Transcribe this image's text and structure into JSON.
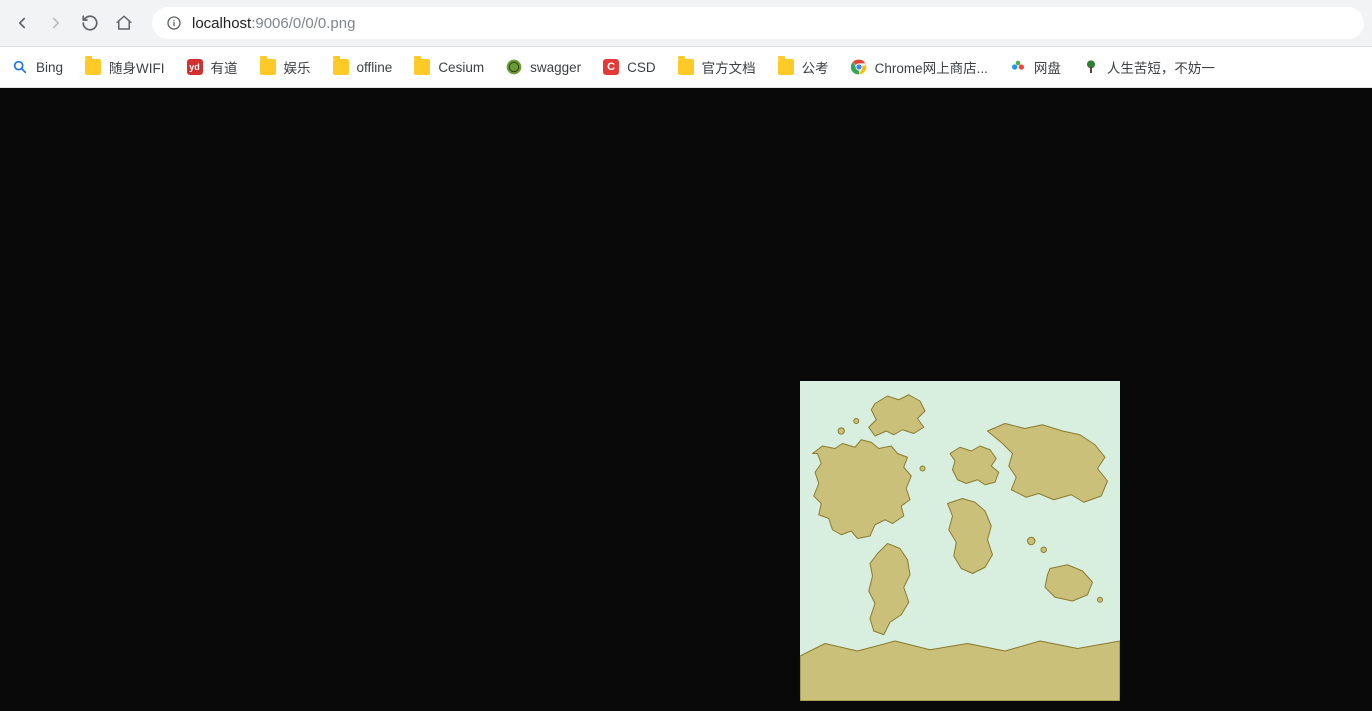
{
  "address": {
    "host": "localhost",
    "port_path": ":9006/0/0/0.png"
  },
  "bookmarks": [
    {
      "label": "Bing",
      "icon": "bing"
    },
    {
      "label": "随身WIFI",
      "icon": "folder"
    },
    {
      "label": "有道",
      "icon": "youdao"
    },
    {
      "label": "娱乐",
      "icon": "folder"
    },
    {
      "label": "offline",
      "icon": "folder"
    },
    {
      "label": "Cesium",
      "icon": "folder"
    },
    {
      "label": "swagger",
      "icon": "swagger"
    },
    {
      "label": "CSD",
      "icon": "csdn"
    },
    {
      "label": "官方文档",
      "icon": "folder"
    },
    {
      "label": "公考",
      "icon": "folder"
    },
    {
      "label": "Chrome网上商店...",
      "icon": "chrome"
    },
    {
      "label": "网盘",
      "icon": "netdisk"
    },
    {
      "label": "人生苦短，不妨一",
      "icon": "tree"
    }
  ],
  "colors": {
    "ocean": "#d8efe0",
    "land_fill": "#cbc07a",
    "land_stroke": "#8a7a2e"
  }
}
